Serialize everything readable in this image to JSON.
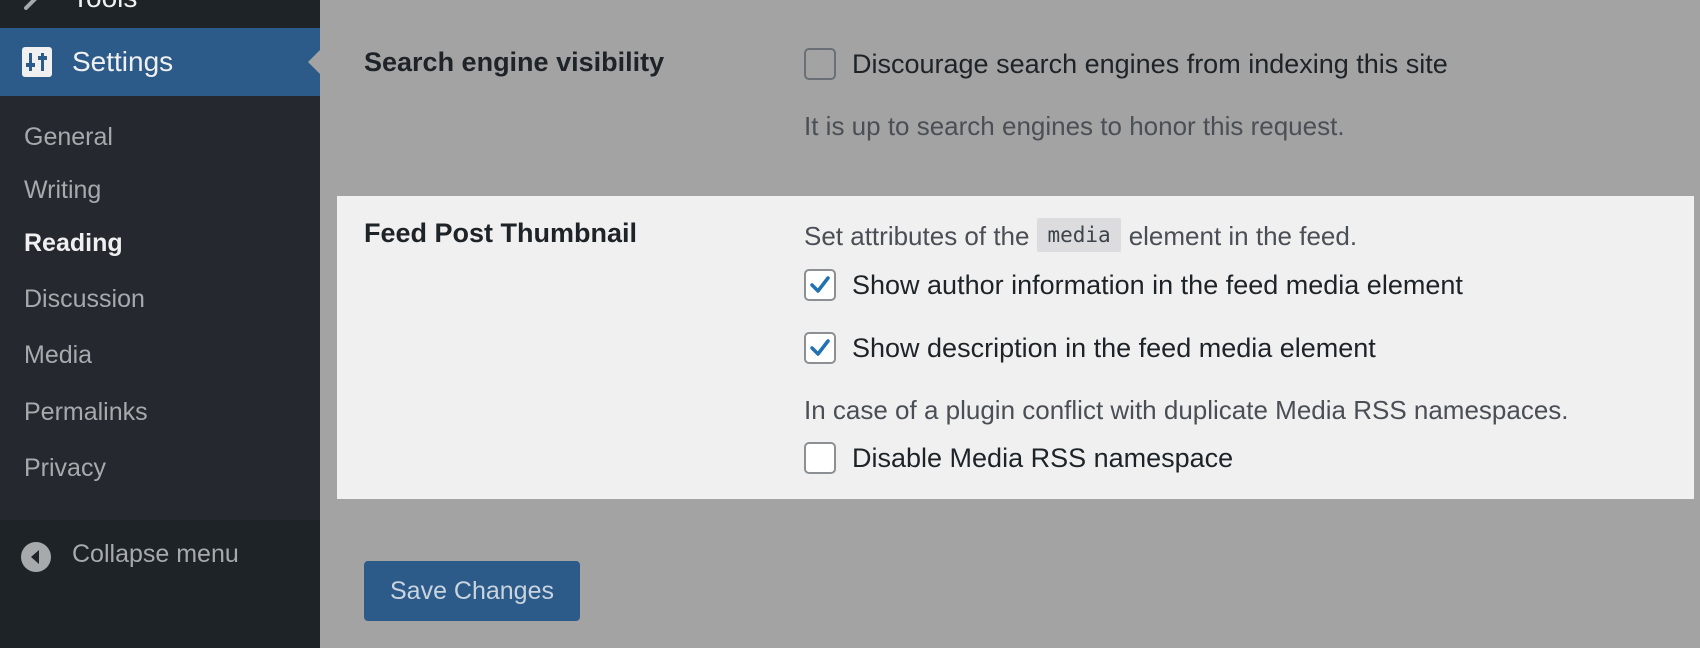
{
  "sidebar": {
    "tools_label": "Tools",
    "settings_label": "Settings",
    "submenu": [
      {
        "label": "General",
        "current": false
      },
      {
        "label": "Writing",
        "current": false
      },
      {
        "label": "Reading",
        "current": true
      },
      {
        "label": "Discussion",
        "current": false
      },
      {
        "label": "Media",
        "current": false
      },
      {
        "label": "Permalinks",
        "current": false
      },
      {
        "label": "Privacy",
        "current": false
      }
    ],
    "collapse_label": "Collapse menu",
    "icons": {
      "tools": "wrench-icon",
      "settings": "settings-sliders-icon",
      "collapse": "collapse-arrow-icon"
    }
  },
  "search_visibility": {
    "label": "Search engine visibility",
    "option": "Discourage search engines from indexing this site",
    "checked": false,
    "help": "It is up to search engines to honor this request."
  },
  "feed_thumbnail": {
    "label": "Feed Post Thumbnail",
    "description_before": "Set attributes of the",
    "description_code": "media",
    "description_after": "element in the feed.",
    "options": [
      {
        "label": "Show author information in the feed media element",
        "checked": true
      },
      {
        "label": "Show description in the feed media element",
        "checked": true
      }
    ],
    "conflict_help": "In case of a plugin conflict with duplicate Media RSS namespaces.",
    "disable_option": {
      "label": "Disable Media RSS namespace",
      "checked": false
    }
  },
  "save_button": "Save Changes",
  "colors": {
    "sidebar_bg": "#1d2327",
    "submenu_bg": "#25292f",
    "accent": "#2c5b8a",
    "overlay_bg": "#a3a3a3",
    "panel_bg": "#f0f0f1",
    "checkmark": "#2271b1"
  }
}
